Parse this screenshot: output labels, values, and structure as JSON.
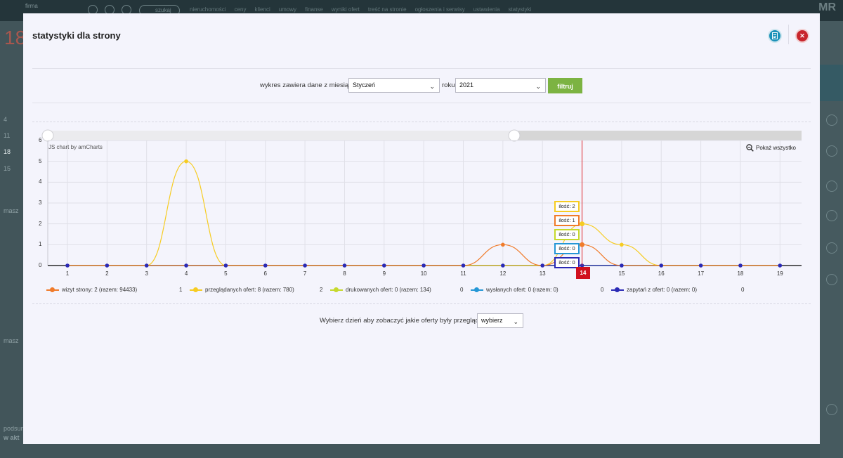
{
  "background": {
    "brand_text": "firma",
    "search_label": "szukaj",
    "nav_items": [
      "nieruchomości",
      "ceny",
      "klienci",
      "umowy",
      "finanse",
      "wyniki ofert",
      "treść na stronie",
      "ogłoszenia i serwisy",
      "ustawienia",
      "statystyki"
    ],
    "big_number": "18",
    "side_texts": [
      "4",
      "11",
      "18",
      "15",
      "masz",
      "masz",
      "podsumowanie",
      "w akt"
    ]
  },
  "modal": {
    "title": "statystyki dla strony",
    "doc_icon": "document-icon",
    "close_icon": "close-icon"
  },
  "filter": {
    "label": "wykres zawiera dane z miesiąca",
    "month_value": "Styczeń",
    "year_label": "roku",
    "year_value": "2021",
    "button_label": "filtruj"
  },
  "chart_controls": {
    "credit": "JS chart by amCharts",
    "show_all": "Pokaż wszystko"
  },
  "cursor": {
    "day": "14",
    "tooltips": [
      "ilość: 2",
      "ilość: 1",
      "ilość: 0",
      "ilość: 0",
      "ilość: 0"
    ]
  },
  "legend": [
    {
      "label": "wizyt strony: 2 (razem: 94433)",
      "value": "1",
      "color": "#f07b2a"
    },
    {
      "label": "przeglądanych ofert: 8 (razem: 780)",
      "value": "2",
      "color": "#f6cc22"
    },
    {
      "label": "drukowanych ofert: 0 (razem: 134)",
      "value": "0",
      "color": "#c6d92c"
    },
    {
      "label": "wysłanych ofert: 0 (razem: 0)",
      "value": "0",
      "color": "#2597d6"
    },
    {
      "label": "zapytań z ofert: 0 (razem: 0)",
      "value": "0",
      "color": "#2b2ab5"
    }
  ],
  "day_picker": {
    "label": "Wybierz dzień aby zobaczyć jakie oferty były przeglądane",
    "value": "wybierz"
  },
  "chart_data": {
    "type": "line",
    "x": [
      1,
      2,
      3,
      4,
      5,
      6,
      7,
      8,
      9,
      10,
      11,
      12,
      13,
      14,
      15,
      16,
      17,
      18,
      19
    ],
    "ylim": [
      0,
      6
    ],
    "yticks": [
      0,
      1,
      2,
      3,
      4,
      5,
      6
    ],
    "grid": true,
    "series": [
      {
        "name": "wizyt strony",
        "color": "#f07b2a",
        "values": [
          0,
          0,
          0,
          0,
          0,
          0,
          0,
          0,
          0,
          0,
          0,
          1,
          0,
          1,
          0,
          0,
          0,
          0,
          0
        ]
      },
      {
        "name": "przeglądanych ofert",
        "color": "#f6cc22",
        "values": [
          0,
          0,
          0,
          5,
          0,
          0,
          0,
          0,
          0,
          0,
          0,
          0,
          0,
          2,
          1,
          0,
          0,
          0,
          0
        ]
      },
      {
        "name": "drukowanych ofert",
        "color": "#c6d92c",
        "values": [
          0,
          0,
          0,
          0,
          0,
          0,
          0,
          0,
          0,
          0,
          0,
          0,
          0,
          0,
          0,
          0,
          0,
          0,
          0
        ]
      },
      {
        "name": "wysłanych ofert",
        "color": "#2597d6",
        "values": [
          0,
          0,
          0,
          0,
          0,
          0,
          0,
          0,
          0,
          0,
          0,
          0,
          0,
          0,
          0,
          0,
          0,
          0,
          0
        ]
      },
      {
        "name": "zapytań z ofert",
        "color": "#2b2ab5",
        "values": [
          0,
          0,
          0,
          0,
          0,
          0,
          0,
          0,
          0,
          0,
          0,
          0,
          0,
          0,
          0,
          0,
          0,
          0,
          0
        ]
      }
    ]
  }
}
